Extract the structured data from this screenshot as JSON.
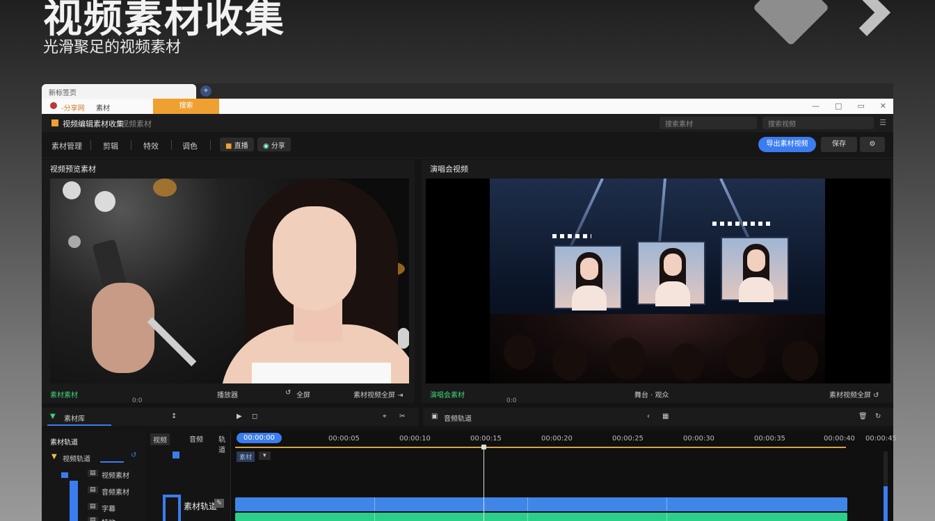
{
  "hero": {
    "title": "视频素材收集",
    "subtitle": "光滑聚足的视频素材"
  },
  "browser": {
    "tab_label": "新标签页",
    "address_text": "-分享网",
    "address_text2": "素材",
    "address_orange": "搜索",
    "window_controls": [
      "—",
      "□",
      "▭",
      "✕"
    ]
  },
  "app": {
    "name": "视频编辑素材收集",
    "subtitle": "视频素材",
    "search1": "搜索素材",
    "search2": "搜索视频",
    "menu_icon": "☰"
  },
  "toolbar": {
    "items": [
      "素材管理",
      "剪辑",
      "特效",
      "调色"
    ],
    "chip1": "直播",
    "chip2": "分享",
    "primary": "导出素材视频",
    "secondary": "保存",
    "more": "⚙"
  },
  "left_panel": {
    "title": "视频预览素材",
    "footer_left": "素材素材",
    "footer_mid": "播放器",
    "footer_right_icon": "↺",
    "footer_right": "全屏",
    "footer_far": "素材视频全屏 ⇥",
    "time": "0:0"
  },
  "right_panel": {
    "title": "演唱会视频",
    "footer_left": "演唱会素材",
    "footer_mid": "舞台 · 观众",
    "footer_far": "素材视频全屏 ↺",
    "time": "0:0"
  },
  "timeline_bar": {
    "left_label": "素材库",
    "left_icon1": "↕",
    "left_icon2": "▶",
    "left_icon3": "◻",
    "left_icon4": "⌖",
    "left_icon5": "✂",
    "right_label": "音频轨道",
    "right_icon1": "‹",
    "right_icon2": "▦",
    "right_icon3": "🗑",
    "right_icon4": "↻"
  },
  "timeline": {
    "sidebar_title": "素材轨道",
    "sidebar_group": "视频轨道",
    "sidebar_items": [
      "视频素材",
      "音频素材",
      "字幕",
      "特效"
    ],
    "col_headers": [
      "视频",
      "音频",
      "轨道"
    ],
    "col_bottom": "素材轨道",
    "ruler_active": "00:00:00",
    "ruler_labels": [
      "00:00:05",
      "00:00:10",
      "00:00:15",
      "00:00:20",
      "00:00:25",
      "00:00:30",
      "00:00:35",
      "00:00:40",
      "00:00:45"
    ],
    "track_chip": "素材"
  }
}
